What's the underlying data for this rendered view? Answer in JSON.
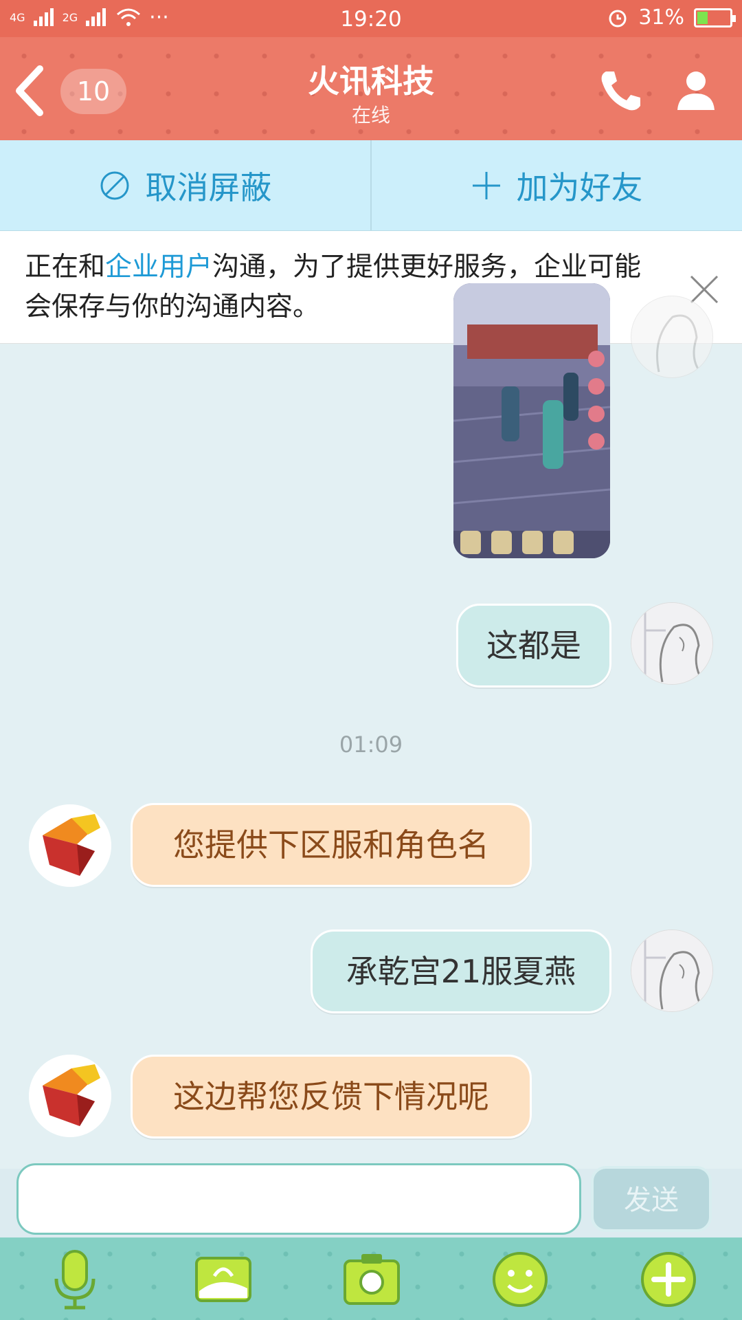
{
  "status_bar": {
    "left_signal_1": "4G",
    "left_signal_2": "2G",
    "more": "···",
    "time": "19:20",
    "battery_percent": "31%"
  },
  "header": {
    "unread_count": "10",
    "title": "火讯科技",
    "subtitle": "在线",
    "icons": [
      "back-chevron-icon",
      "phone-icon",
      "profile-icon"
    ]
  },
  "actions": {
    "unblock_label": "取消屏蔽",
    "add_friend_label": "加为好友"
  },
  "notice": {
    "before": "正在和",
    "highlight": "企业用户",
    "after": "沟通，为了提供更好服务，企业可能会保存与你的沟通内容。"
  },
  "chat": {
    "messages": [
      {
        "from": "me",
        "type": "image"
      },
      {
        "from": "me",
        "text": "这都是"
      },
      {
        "timestamp": "01:09"
      },
      {
        "from": "them",
        "text": "您提供下区服和角色名"
      },
      {
        "from": "me",
        "text": "承乾宫21服夏燕"
      },
      {
        "from": "them",
        "text": "这边帮您反馈下情况呢"
      }
    ]
  },
  "composer": {
    "send_label": "发送"
  },
  "toolbar": {
    "icons": [
      "microphone-icon",
      "gallery-icon",
      "camera-icon",
      "emoji-icon",
      "plus-icon"
    ]
  },
  "colors": {
    "header": "#ec7a68",
    "accent_blue": "#1e9ad6",
    "toolbar": "#84d0c4"
  }
}
